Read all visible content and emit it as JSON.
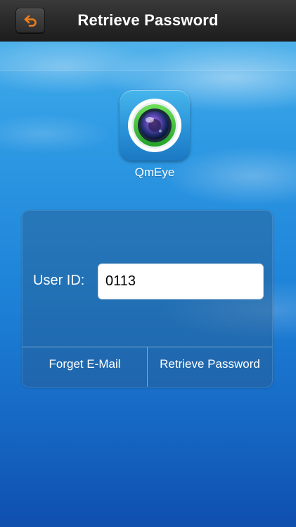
{
  "navbar": {
    "title": "Retrieve Password",
    "back_icon": "back-arrow-icon",
    "back_icon_color": "#f07d1a"
  },
  "app": {
    "name": "QmEye",
    "icon": "camera-lens-icon"
  },
  "form": {
    "user_id_label": "User ID:",
    "user_id_value": "0113",
    "forget_email_label": "Forget E-Mail",
    "retrieve_password_label": "Retrieve Password"
  },
  "colors": {
    "navbar": "#2a2a2a",
    "background_top": "#4ab3ec",
    "background_bottom": "#0f4fae",
    "lens_ring": "#3cc43a"
  }
}
